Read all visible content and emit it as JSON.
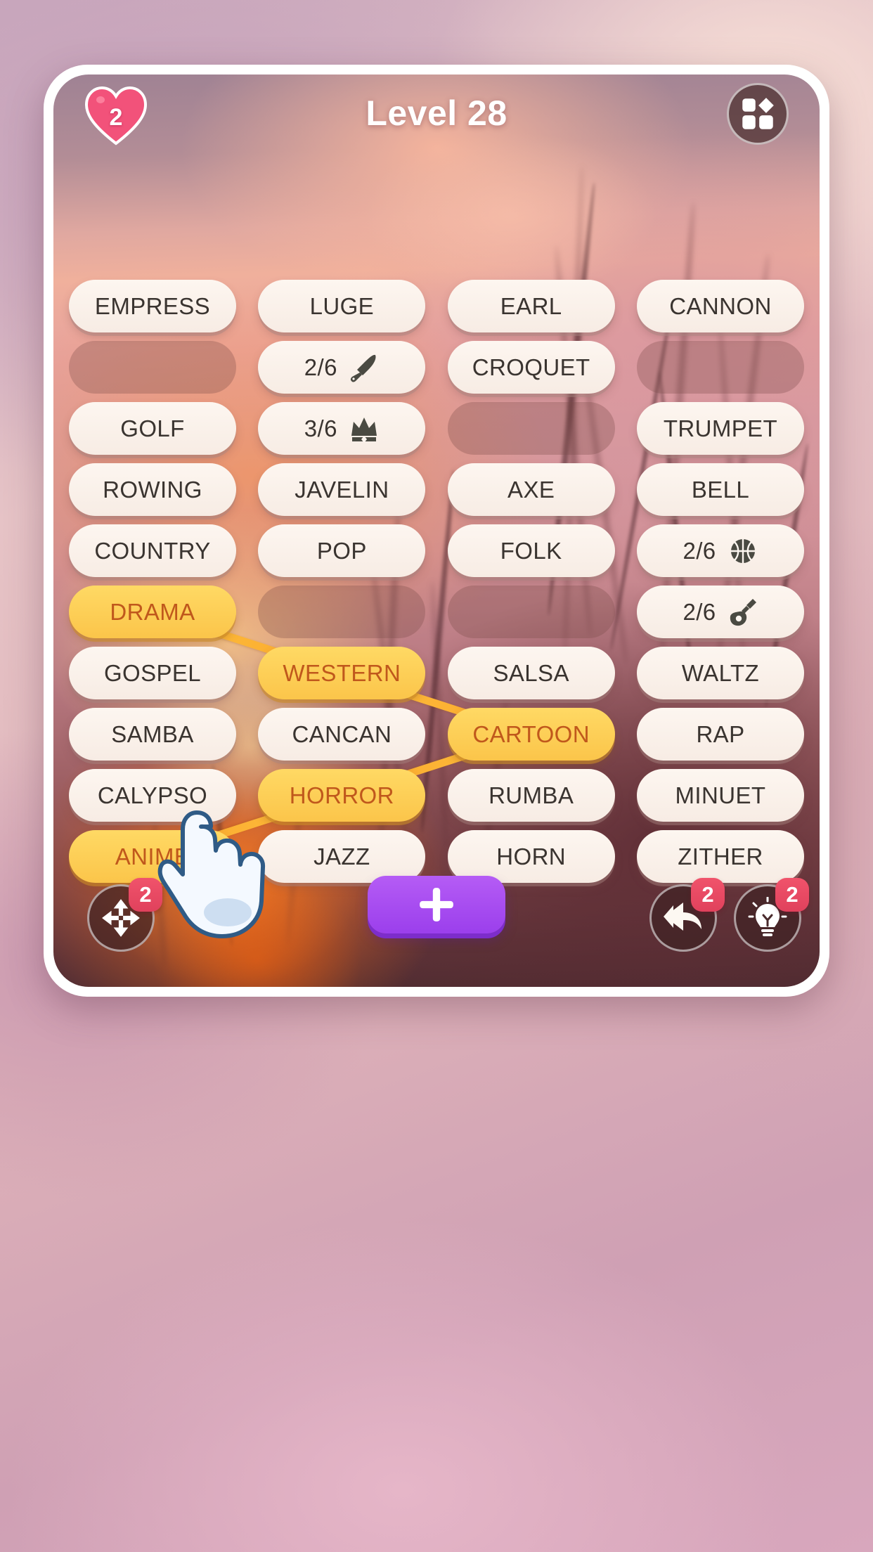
{
  "header": {
    "title": "Level 28",
    "lives": "2",
    "lives_icon": "heart-icon",
    "menu_icon": "grid-puzzle-icon"
  },
  "grid": {
    "rows": [
      [
        {
          "type": "word",
          "label": "EMPRESS",
          "state": "normal"
        },
        {
          "type": "word",
          "label": "LUGE",
          "state": "normal"
        },
        {
          "type": "word",
          "label": "EARL",
          "state": "normal"
        },
        {
          "type": "word",
          "label": "CANNON",
          "state": "normal"
        }
      ],
      [
        {
          "type": "empty",
          "label": "",
          "state": "empty"
        },
        {
          "type": "counter",
          "label": "2/6",
          "icon": "knife-icon",
          "state": "normal"
        },
        {
          "type": "word",
          "label": "CROQUET",
          "state": "normal"
        },
        {
          "type": "empty",
          "label": "",
          "state": "empty"
        }
      ],
      [
        {
          "type": "word",
          "label": "GOLF",
          "state": "normal"
        },
        {
          "type": "counter",
          "label": "3/6",
          "icon": "crown-icon",
          "state": "normal"
        },
        {
          "type": "empty",
          "label": "",
          "state": "empty"
        },
        {
          "type": "word",
          "label": "TRUMPET",
          "state": "normal"
        }
      ],
      [
        {
          "type": "word",
          "label": "ROWING",
          "state": "normal"
        },
        {
          "type": "word",
          "label": "JAVELIN",
          "state": "normal"
        },
        {
          "type": "word",
          "label": "AXE",
          "state": "normal"
        },
        {
          "type": "word",
          "label": "BELL",
          "state": "normal"
        }
      ],
      [
        {
          "type": "word",
          "label": "COUNTRY",
          "state": "normal"
        },
        {
          "type": "word",
          "label": "POP",
          "state": "normal"
        },
        {
          "type": "word",
          "label": "FOLK",
          "state": "normal"
        },
        {
          "type": "counter",
          "label": "2/6",
          "icon": "basketball-icon",
          "state": "normal"
        }
      ],
      [
        {
          "type": "word",
          "label": "DRAMA",
          "state": "selected"
        },
        {
          "type": "empty",
          "label": "",
          "state": "empty"
        },
        {
          "type": "empty",
          "label": "",
          "state": "empty"
        },
        {
          "type": "counter",
          "label": "2/6",
          "icon": "guitar-icon",
          "state": "normal"
        }
      ],
      [
        {
          "type": "word",
          "label": "GOSPEL",
          "state": "normal"
        },
        {
          "type": "word",
          "label": "WESTERN",
          "state": "selected"
        },
        {
          "type": "word",
          "label": "SALSA",
          "state": "normal"
        },
        {
          "type": "word",
          "label": "WALTZ",
          "state": "normal"
        }
      ],
      [
        {
          "type": "word",
          "label": "SAMBA",
          "state": "normal"
        },
        {
          "type": "word",
          "label": "CANCAN",
          "state": "normal"
        },
        {
          "type": "word",
          "label": "CARTOON",
          "state": "selected"
        },
        {
          "type": "word",
          "label": "RAP",
          "state": "normal"
        }
      ],
      [
        {
          "type": "word",
          "label": "CALYPSO",
          "state": "normal"
        },
        {
          "type": "word",
          "label": "HORROR",
          "state": "selected"
        },
        {
          "type": "word",
          "label": "RUMBA",
          "state": "normal"
        },
        {
          "type": "word",
          "label": "MINUET",
          "state": "normal"
        }
      ],
      [
        {
          "type": "word",
          "label": "ANIME",
          "state": "selected"
        },
        {
          "type": "word",
          "label": "JAZZ",
          "state": "normal"
        },
        {
          "type": "word",
          "label": "HORN",
          "state": "normal"
        },
        {
          "type": "word",
          "label": "ZITHER",
          "state": "normal"
        }
      ]
    ],
    "selected_path": [
      "DRAMA",
      "WESTERN",
      "CARTOON",
      "HORROR",
      "ANIME"
    ]
  },
  "bottom_bar": {
    "shuffle": {
      "icon": "move-arrows-icon",
      "badge": "2"
    },
    "add": {
      "icon": "plus-icon",
      "label": "+"
    },
    "undo": {
      "icon": "undo-arrow-icon",
      "badge": "2"
    },
    "hint": {
      "icon": "lightbulb-icon",
      "badge": "2"
    }
  },
  "cursor": {
    "icon": "pointing-hand-icon"
  },
  "colors": {
    "tile_bg": "#fdf6f0",
    "tile_selected": "#ffd964",
    "selected_text": "#c0581c",
    "link_line": "#f9a52c",
    "badge_red": "#e0415c",
    "heart_pink": "#f2527a",
    "add_purple": "#9b3fec",
    "title_white": "#ffffff"
  }
}
